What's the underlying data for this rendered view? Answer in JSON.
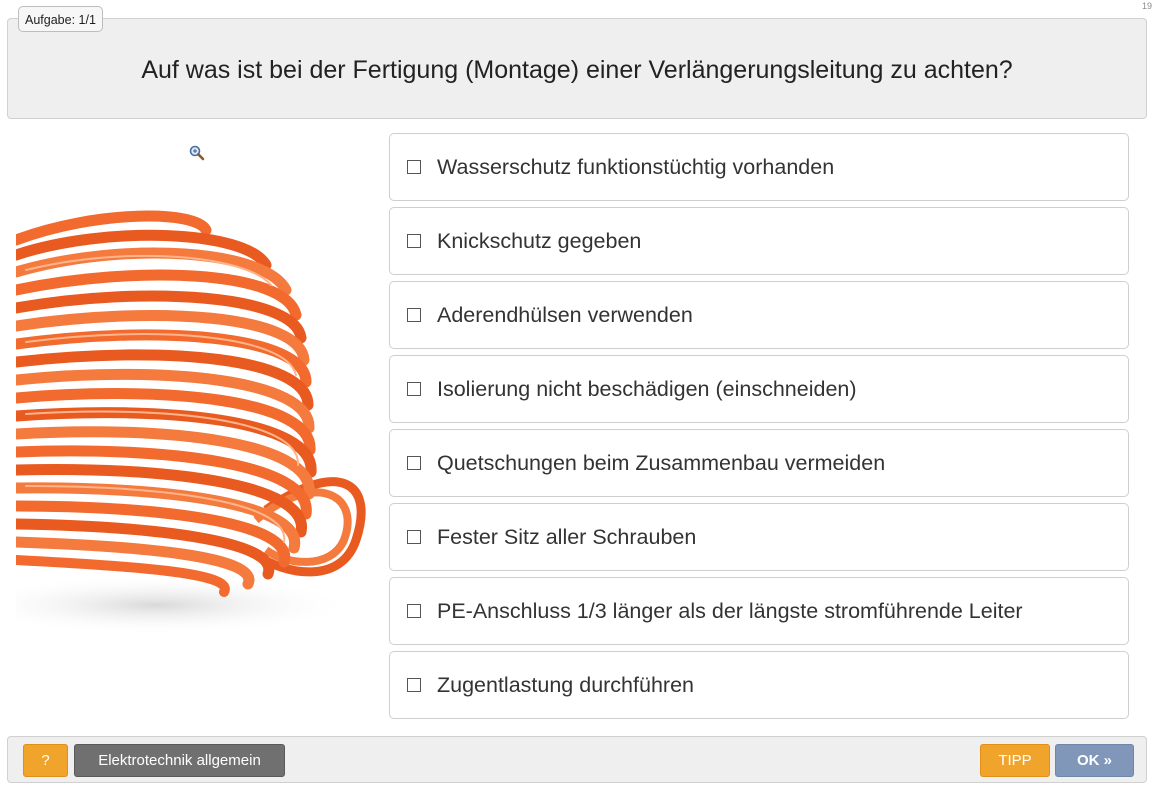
{
  "page_number": "19",
  "task_badge": "Aufgabe: 1/1",
  "question": "Auf was ist bei der Fertigung (Montage) einer Verlängerungsleitung zu achten?",
  "image": {
    "zoom_icon": "magnifier-zoom-icon",
    "subject": "coil of orange extension cable"
  },
  "answers": [
    {
      "label": "Wasserschutz funktionstüchtig vorhanden",
      "checked": false
    },
    {
      "label": "Knickschutz gegeben",
      "checked": false
    },
    {
      "label": "Aderendhülsen verwenden",
      "checked": false
    },
    {
      "label": "Isolierung nicht beschädigen (einschneiden)",
      "checked": false
    },
    {
      "label": "Quetschungen beim Zusammenbau vermeiden",
      "checked": false
    },
    {
      "label": "Fester Sitz aller Schrauben",
      "checked": false
    },
    {
      "label": "PE-Anschluss 1/3 länger als der längste stromführende Leiter",
      "checked": false
    },
    {
      "label": "Zugentlastung durchführen",
      "checked": false
    }
  ],
  "footer": {
    "help_label": "?",
    "category_label": "Elektrotechnik allgemein",
    "tip_label": "TIPP",
    "ok_label": "OK »"
  },
  "colors": {
    "accent_orange": "#f0a42b",
    "ok_blue": "#8197b9",
    "category_gray": "#707070",
    "cable_orange": "#f26a2e"
  }
}
